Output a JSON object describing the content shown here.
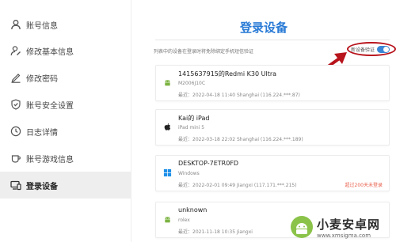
{
  "sidebar": {
    "items": [
      {
        "label": "账号信息",
        "icon": "user-icon"
      },
      {
        "label": "修改基本信息",
        "icon": "user-edit-icon"
      },
      {
        "label": "修改密码",
        "icon": "pen-icon"
      },
      {
        "label": "账号安全设置",
        "icon": "shield-check-icon"
      },
      {
        "label": "日志详情",
        "icon": "clock-icon"
      },
      {
        "label": "账号游戏信息",
        "icon": "cup-icon"
      },
      {
        "label": "登录设备",
        "icon": "device-icon",
        "active": true
      }
    ]
  },
  "main": {
    "title": "登录设备",
    "hint": "列表中的设备在登录时将免除绑定手机短信验证",
    "toggle": {
      "label": "新设备验证",
      "on": true
    },
    "devices": [
      {
        "name": "1415637915的Redmi K30 Ultra",
        "model": "M2006J10C",
        "login": "最近：2022-04-18 11:40   Shanghai (116.224.***.87)",
        "icon": "android-icon",
        "note": ""
      },
      {
        "name": "Kai的 iPad",
        "model": "iPad mini 5",
        "login": "最近：2022-03-18 22:02   Shanghai (116.224.***.189)",
        "icon": "apple-icon",
        "note": ""
      },
      {
        "name": "DESKTOP-7ETR0FD",
        "model": "Windows",
        "login": "最近：2022-02-01 09:49   Jiangxi (117.171.***.215)",
        "icon": "windows-icon",
        "note": "超过200天未登录"
      },
      {
        "name": "unknown",
        "model": "rolex",
        "login": "最近：2021-11-18 10:35   Jiangxi",
        "icon": "android-icon",
        "note": ""
      }
    ]
  },
  "watermark": {
    "title": "小麦安卓网",
    "url": "www.xmsigma.com"
  },
  "colors": {
    "accent": "#2a7bd6",
    "toggle": "#3a86d6",
    "annotation": "#b8141c",
    "android": "#7cb342",
    "windows": "#1e90e8",
    "warning": "#e8604c"
  }
}
